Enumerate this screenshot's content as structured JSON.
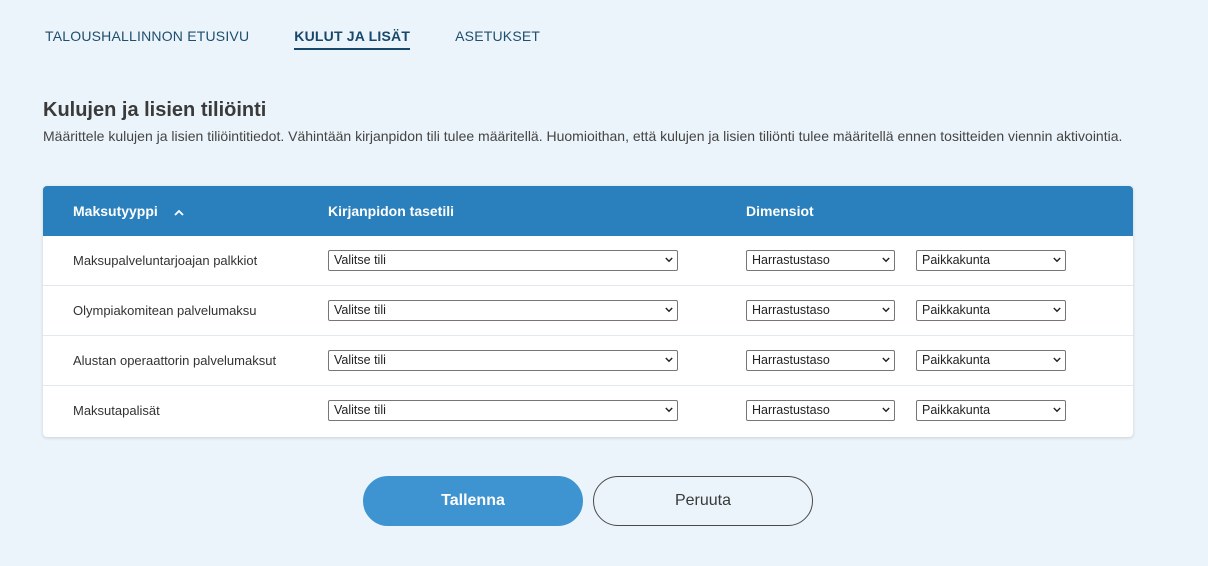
{
  "nav": {
    "tabs": [
      {
        "label": "TALOUSHALLINNON ETUSIVU"
      },
      {
        "label": "KULUT JA LISÄT"
      },
      {
        "label": "ASETUKSET"
      }
    ]
  },
  "page": {
    "title": "Kulujen ja lisien tiliöinti",
    "description": "Määrittele kulujen ja lisien tiliöintitiedot. Vähintään kirjanpidon tili tulee määritellä. Huomioithan, että kulujen ja lisien tiliönti tulee määritellä ennen tositteiden viennin aktivointia."
  },
  "table": {
    "headers": {
      "type": "Maksutyyppi",
      "account": "Kirjanpidon tasetili",
      "dimensions": "Dimensiot"
    },
    "rows": [
      {
        "type": "Maksupalveluntarjoajan palkkiot",
        "account": "Valitse tili",
        "dim1": "Harrastustaso",
        "dim2": "Paikkakunta"
      },
      {
        "type": "Olympiakomitean palvelumaksu",
        "account": "Valitse tili",
        "dim1": "Harrastustaso",
        "dim2": "Paikkakunta"
      },
      {
        "type": "Alustan operaattorin palvelumaksut",
        "account": "Valitse tili",
        "dim1": "Harrastustaso",
        "dim2": "Paikkakunta"
      },
      {
        "type": "Maksutapalisät",
        "account": "Valitse tili",
        "dim1": "Harrastustaso",
        "dim2": "Paikkakunta"
      }
    ]
  },
  "actions": {
    "save_label": "Tallenna",
    "cancel_label": "Peruuta"
  },
  "colors": {
    "background": "#ebf4fa",
    "header": "#2a80bc",
    "primary_button": "#3d94d0",
    "nav_active": "#17476b"
  }
}
